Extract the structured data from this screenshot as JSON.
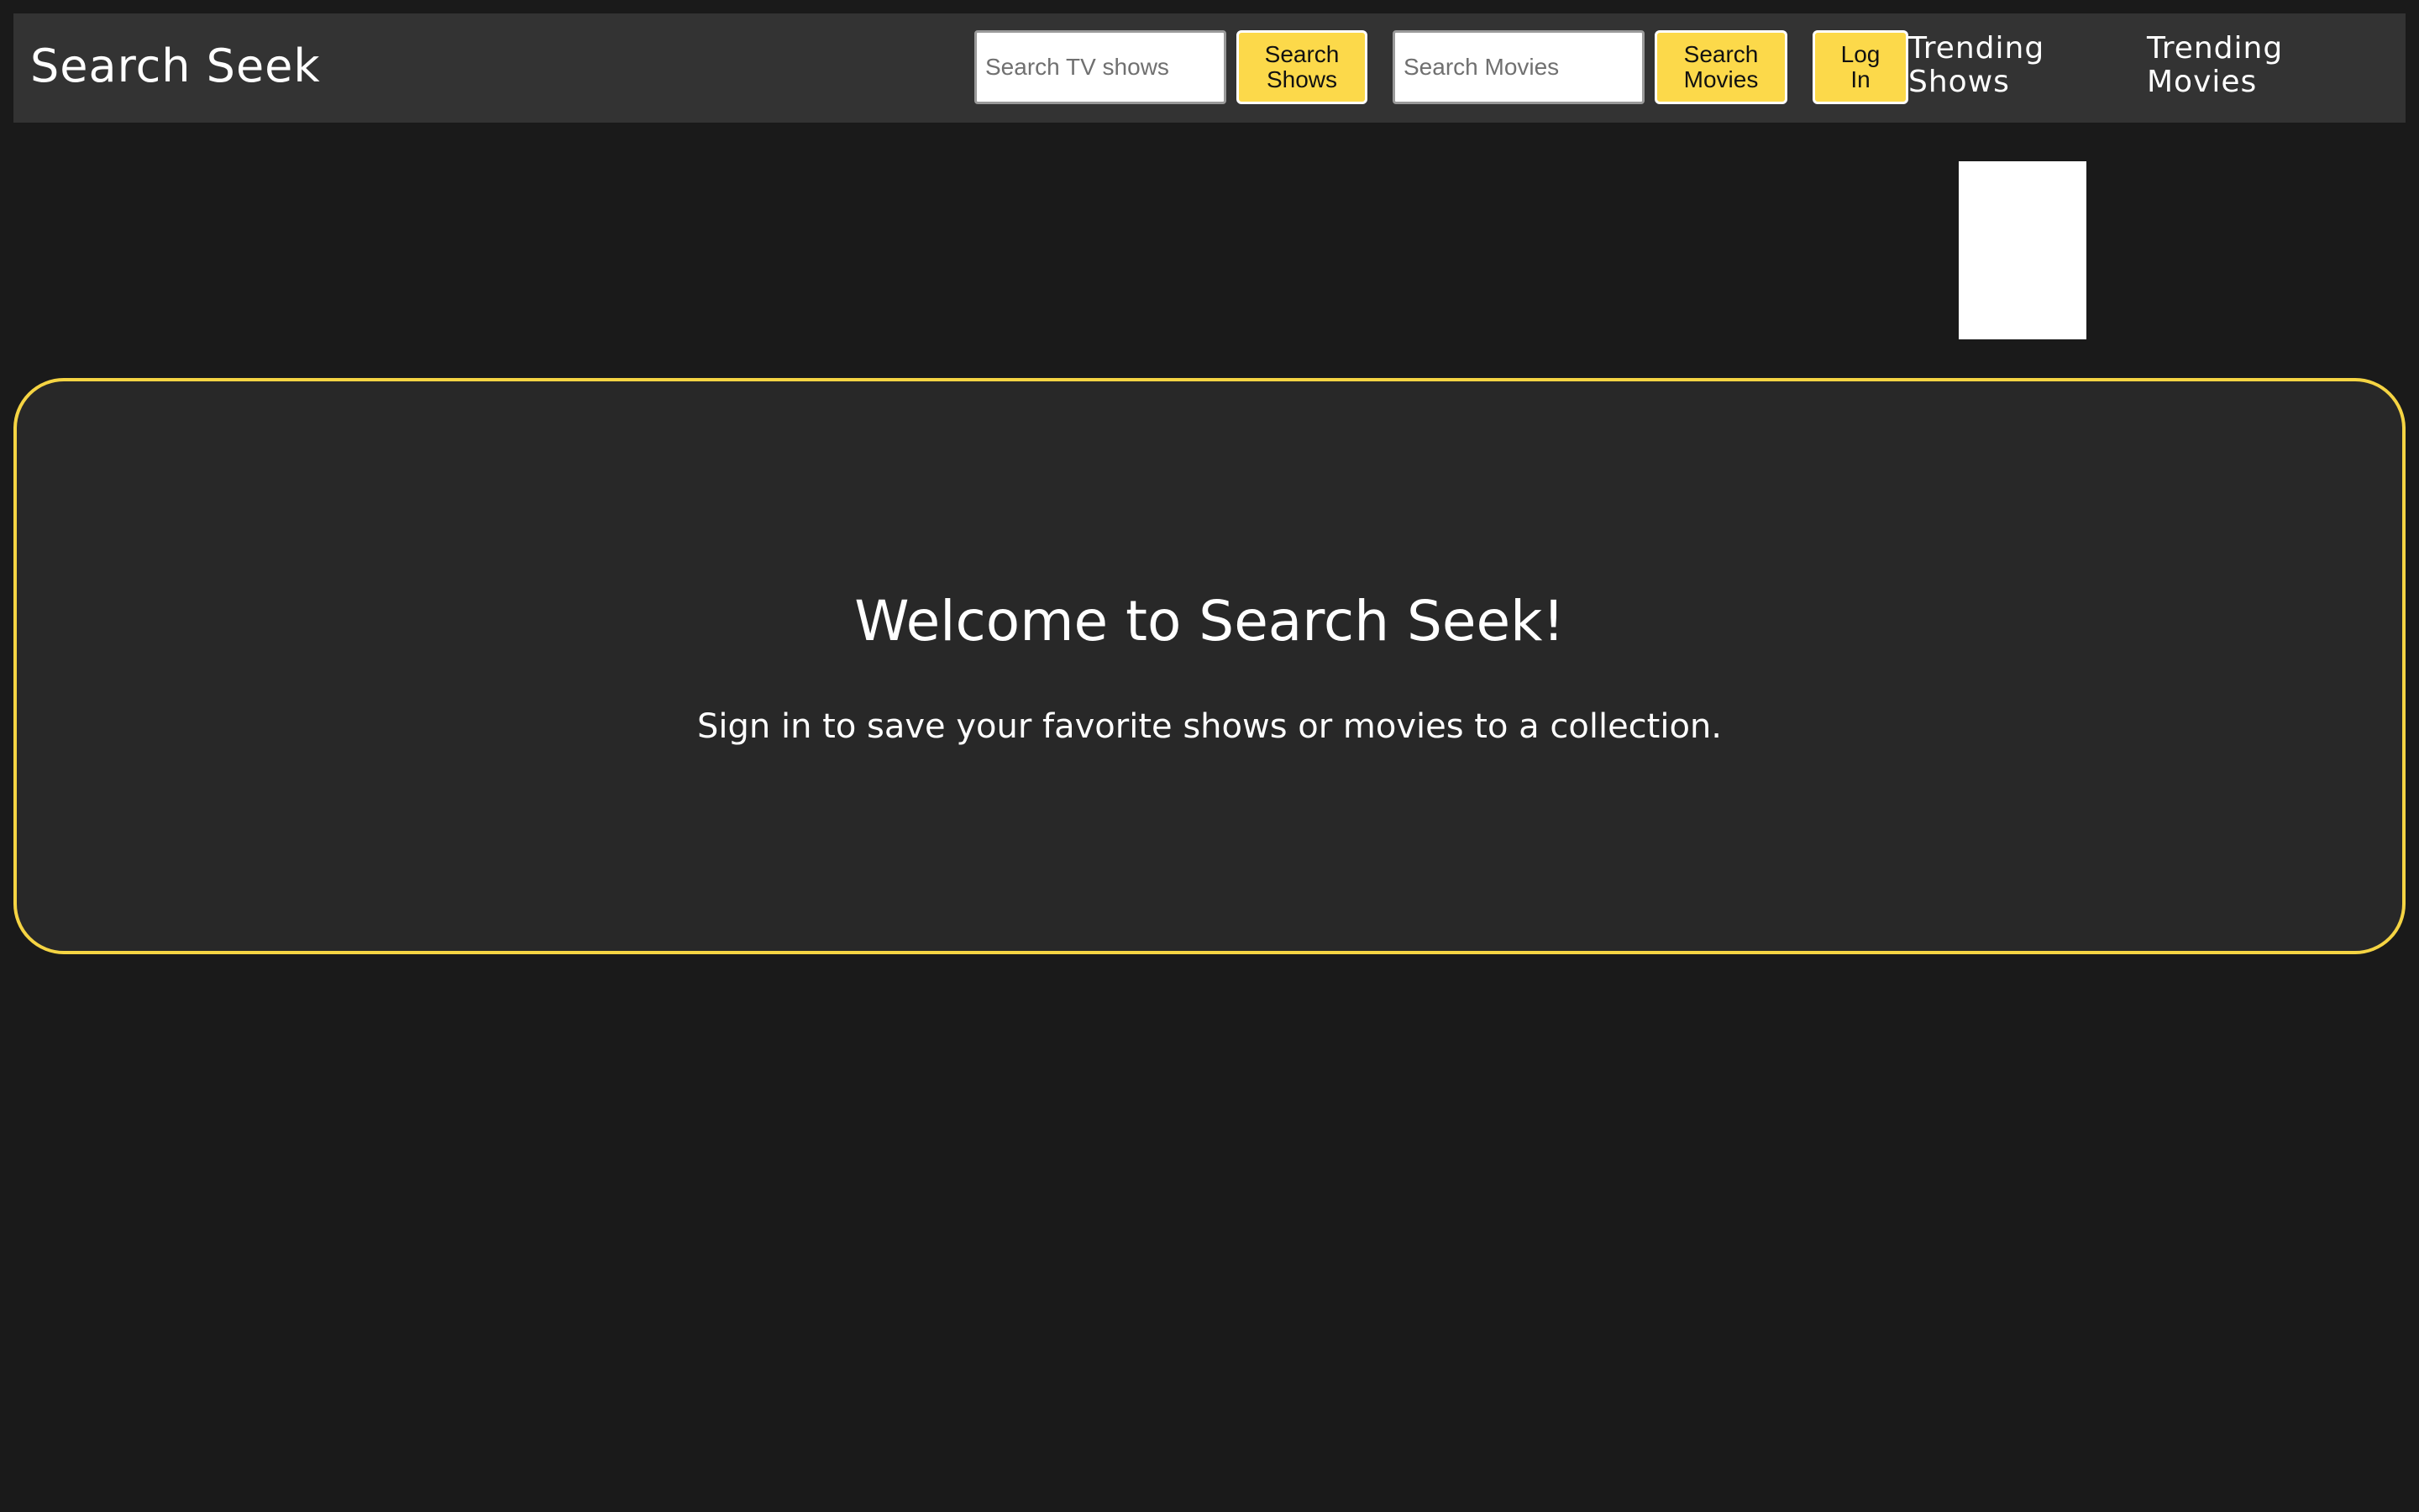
{
  "header": {
    "brand": "Search Seek",
    "shows_search": {
      "placeholder": "Search TV shows",
      "value": "",
      "button_line1": "Search",
      "button_line2": "Shows"
    },
    "movies_search": {
      "placeholder": "Search Movies",
      "value": "",
      "button_line1": "Search",
      "button_line2": "Movies"
    },
    "login": {
      "line1": "Log",
      "line2": "In"
    },
    "nav": {
      "trending_shows_line1": "Trending",
      "trending_shows_line2": "Shows",
      "trending_movies_line1": "Trending",
      "trending_movies_line2": "Movies"
    }
  },
  "welcome": {
    "title": "Welcome to Search Seek!",
    "subtitle": "Sign in to save your favorite shows or movies to a collection."
  },
  "colors": {
    "background": "#1a1a1a",
    "navbar": "#333333",
    "card": "#282828",
    "accent_yellow": "#fcd94a",
    "card_border": "#f5d443",
    "text": "#ffffff"
  }
}
